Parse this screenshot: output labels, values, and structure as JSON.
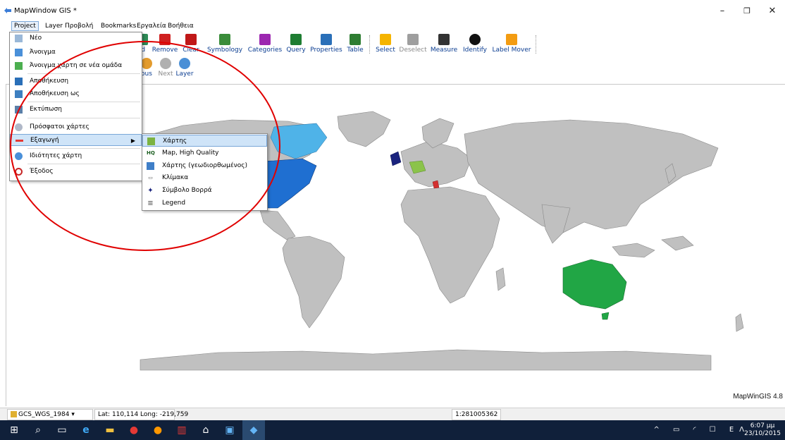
{
  "window": {
    "title": "MapWindow GIS *",
    "minimize": "–",
    "maximize": "❐",
    "close": "✕"
  },
  "menubar": [
    {
      "label": "Project"
    },
    {
      "label": "Layer"
    },
    {
      "label": "Προβολή"
    },
    {
      "label": "Bookmarks"
    },
    {
      "label": "Εργαλεία"
    },
    {
      "label": "Βοήθεια"
    }
  ],
  "toolbar": {
    "row1": [
      {
        "label": "ld",
        "icon": "add-layer-icon",
        "color": "#2e8b57"
      },
      {
        "label": "Remove",
        "icon": "remove-layer-icon",
        "color": "#d02020"
      },
      {
        "label": "Clear",
        "icon": "clear-icon",
        "color": "#c01818"
      },
      {
        "label": "Symbology",
        "icon": "symbology-icon",
        "color": "#3a8c3a"
      },
      {
        "label": "Categories",
        "icon": "categories-icon",
        "color": "#9c27b0"
      },
      {
        "label": "Query",
        "icon": "query-icon",
        "color": "#1e7d32"
      },
      {
        "label": "Properties",
        "icon": "properties-icon",
        "color": "#2a6fb8"
      },
      {
        "label": "Table",
        "icon": "table-icon",
        "color": "#2e7d32"
      },
      {
        "label": "Select",
        "icon": "select-icon",
        "color": "#f5b400"
      },
      {
        "label": "Deselect",
        "icon": "deselect-icon",
        "color": "#9e9e9e"
      },
      {
        "label": "Measure",
        "icon": "measure-icon",
        "color": "#333333"
      },
      {
        "label": "Identify",
        "icon": "identify-icon",
        "color": "#111111"
      },
      {
        "label": "Label Mover",
        "icon": "label-mover-icon",
        "color": "#f39c12"
      }
    ],
    "row2": [
      {
        "label": "ous",
        "icon": "previous-extent-icon",
        "color": "#e39b2d"
      },
      {
        "label": "Next",
        "icon": "next-extent-icon",
        "color": "#b0b0b0"
      },
      {
        "label": "Layer",
        "icon": "zoom-layer-icon",
        "color": "#4a8fd6"
      }
    ]
  },
  "project_menu": {
    "items": [
      {
        "label": "Νέο",
        "icon": "new-icon"
      },
      {
        "label": "Άνοιγμα",
        "icon": "open-icon"
      },
      {
        "label": "Άνοιγμα χάρτη σε νέα ομάδα",
        "icon": "open-group-icon"
      },
      {
        "label": "Αποθήκευση",
        "icon": "save-icon"
      },
      {
        "label": "Αποθήκευση ως",
        "icon": "save-as-icon"
      },
      {
        "label": "Εκτύπωση",
        "icon": "print-icon"
      },
      {
        "label": "Πρόσφατοι χάρτες",
        "icon": "recent-icon"
      },
      {
        "label": "Εξαγωγή",
        "icon": "export-icon"
      },
      {
        "label": "Ιδιότητες χάρτη",
        "icon": "properties-icon"
      },
      {
        "label": "Έξοδος",
        "icon": "exit-icon"
      }
    ],
    "submenu_arrow": "▶"
  },
  "export_submenu": {
    "items": [
      {
        "label": "Χάρτης",
        "icon": "map-icon",
        "glyph": ""
      },
      {
        "label": "Map, High Quality",
        "icon": "hq-icon",
        "glyph": "HQ"
      },
      {
        "label": "Χάρτης (γεωδιορθωμένος)",
        "icon": "georeferenced-map-icon",
        "glyph": ""
      },
      {
        "label": "Κλίμακα",
        "icon": "scalebar-icon",
        "glyph": "▭"
      },
      {
        "label": "Σύμβολο Βορρά",
        "icon": "north-arrow-icon",
        "glyph": "✦"
      },
      {
        "label": "Legend",
        "icon": "legend-icon",
        "glyph": "≡"
      }
    ]
  },
  "map": {
    "watermark": "MapWinGIS 4.8",
    "land_color": "#c0c0c0",
    "border_color": "#888888"
  },
  "statusbar": {
    "projection": "GCS_WGS_1984",
    "coords": "Lat: 110,114 Long: -219,759",
    "scale": "1:281005362"
  },
  "taskbar": {
    "language": "ΕΛ",
    "time": "6:07 μμ",
    "date": "23/10/2015"
  }
}
